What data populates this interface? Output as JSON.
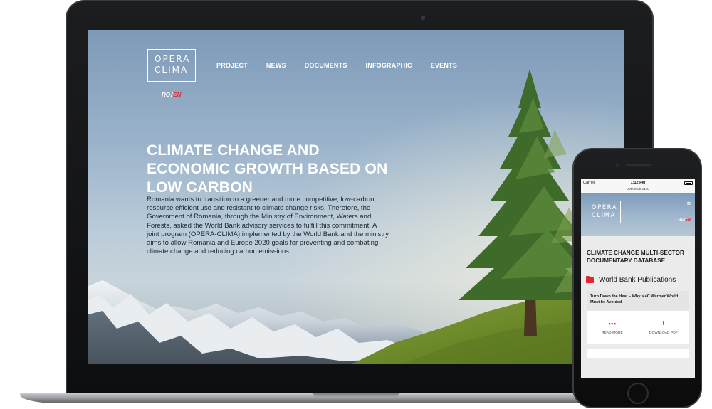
{
  "desktop": {
    "logo": {
      "line1": "OPERA",
      "line2": "CLIMA"
    },
    "nav": [
      "PROJECT",
      "NEWS",
      "DOCUMENTS",
      "INFOGRAPHIC",
      "EVENTS"
    ],
    "lang": {
      "ro": "RO",
      "sep": "/",
      "en": "EN"
    },
    "hero_title": "CLIMATE CHANGE AND ECONOMIC GROWTH BASED ON LOW CARBON",
    "hero_text": "Romania wants to transition to a greener and more competitive, low-carbon, resource efficient use and resistant to climate change risks. Therefore, the Government of Romania, through the Ministry of Environment, Waters and Forests, asked the World Bank advisory services to fulfill this commitment. A joint program (OPERA-CLIMA) implemented by the World Bank and the ministry aims to allow Romania and Europe 2020 goals for preventing and combating climate change and reducing carbon emissions."
  },
  "mobile": {
    "status": {
      "carrier": "Carrier",
      "time": "1:12 PM"
    },
    "url": "opera-clima.ro",
    "logo": {
      "line1": "OPERA",
      "line2": "CLIMA"
    },
    "menu_icon": "hamburger-icon",
    "lang": {
      "ro": "RO",
      "sep": "/",
      "en": "EN"
    },
    "section_title": "CLIMATE CHANGE MULTI-SECTOR DOCUMENTARY DATABASE",
    "publications_label": "World Bank Publications",
    "card": {
      "title": "Turn Down the Heat – Why a 4C Warmer World Must be Avoided",
      "read_more": "READ MORE",
      "download": "DOWNLOAD PDF"
    }
  },
  "colors": {
    "accent_red": "#e5252b",
    "sky": "#9cb4cb",
    "device": "#111214"
  }
}
